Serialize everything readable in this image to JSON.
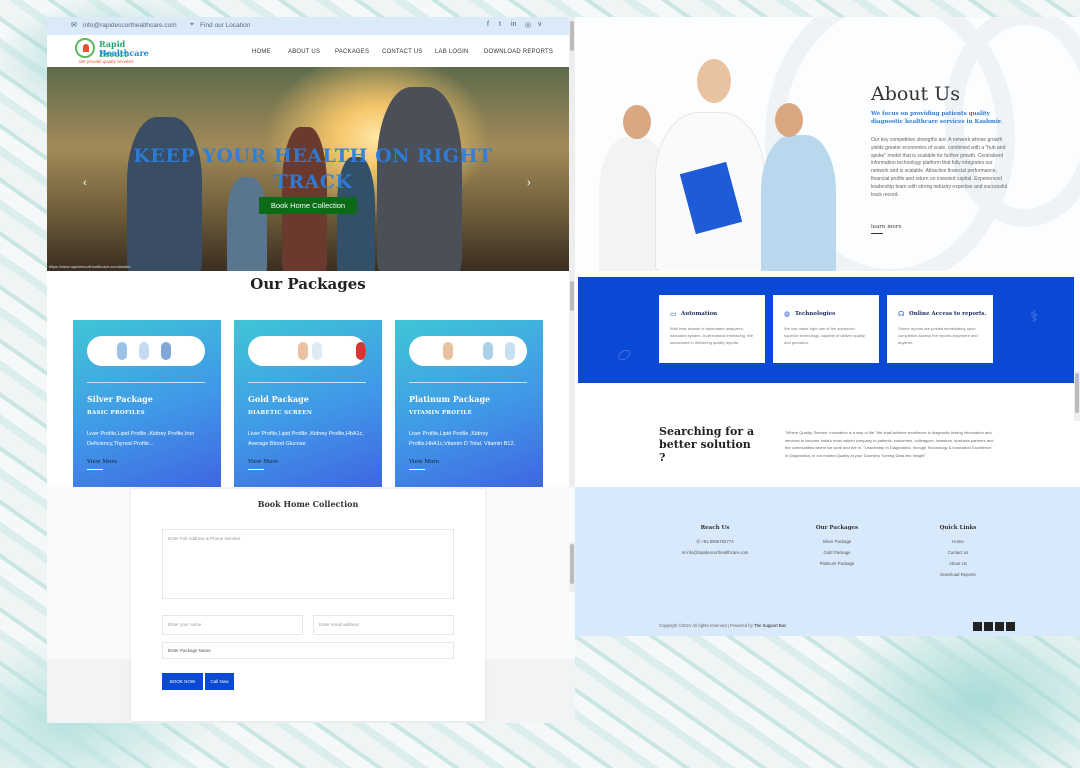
{
  "topbar": {
    "email": "info@rapidescorthealthcare.com",
    "location": "Find our Location",
    "social": [
      "f",
      "t",
      "in",
      "◎",
      "v"
    ]
  },
  "logo": {
    "line1": "Rapid Escort",
    "line2": "Healthcare",
    "tagline": "We provide quality services"
  },
  "nav": [
    "HOME",
    "ABOUT US",
    "PACKAGES",
    "CONTACT US",
    "LAB LOGIN",
    "DOWNLOAD REPORTS"
  ],
  "hero": {
    "headline": "KEEP YOUR HEALTH ON RIGHT TRACK",
    "button": "Book Home Collection",
    "url": "https://www.rapidescorthealthcare.com/#slider"
  },
  "about": {
    "title": "About Us",
    "lead": "We focus on providing patients quality diagnostic healthcare services in Kashmir.",
    "body": "Our key competitive strengths are: A network whose growth yields greater economies of scale, combined with a \"hub and spoke\" model that is scalable for further growth. Centralized information technology platform that fully integrates our network and is scalable. Attractive financial performance, financial profile and return on invested capital. Experienced leadership team with strong industry expertise and successful track record.",
    "more": "learn more"
  },
  "packages": {
    "title": "Our Packages",
    "items": [
      {
        "name": "Silver Package",
        "profile": "BASIC PROFILES",
        "desc": "Liver Profile,Lipid Profile ,Kidney Profile,Iron Deficiency,Thyroid Profile...",
        "link": "View More"
      },
      {
        "name": "Gold Package",
        "profile": "DIABETIC SCREEN",
        "desc": "Liver Profile,Lipid Profile ,Kidney Profile,HbA1c, Average Blood Glucose",
        "link": "View More"
      },
      {
        "name": "Platinum Package",
        "profile": "VITAMIN PROFILE",
        "desc": "Liver Profile,Lipid Profile ,Kidney Profile,HbA1c,Vitamin D Total, Vitamin B12,",
        "link": "View More"
      }
    ]
  },
  "features": [
    {
      "title": "Automation",
      "icon": "monitor-icon",
      "desc": "With best brands of automated analyzers, barcoded system, bi-directional interfacing, We succeeded in delivering quality reports."
    },
    {
      "title": "Technologies",
      "icon": "globe-icon",
      "desc": "We has made right use of the advanced superior technology, capable of deliver quality and precision."
    },
    {
      "title": "Online Access to reports.",
      "icon": "headset-icon",
      "desc": "Online reports are posted immediately upon completion Access the reports anywhere and anytime."
    }
  ],
  "search": {
    "question": "Searching for a better solution ?",
    "quote": "\"Where Quality, Service, Innovation is a way of life\" We shall achieve excellence in diagnostic testing information and services to become India's most valued company to patients, customers, colleagues, investors, business partners and the communities where we work and live in. \"Leadership in Diagnostics, through Technology & Innovation Excellence in Diagnostics, in our mantra Quality at your Doorstep Turning Data into Insight\""
  },
  "booking": {
    "title": "Book Home Collection",
    "address_ph": "Enter Full Address & Phone Number",
    "name_ph": "Enter your name",
    "email_ph": "Enter email address",
    "package_ph": "Enter Package Name",
    "book": "BOOK NOW",
    "call": "Call Now"
  },
  "footer": {
    "reach": {
      "title": "Reach Us",
      "phone": "+91 9906792774",
      "email": "info@rapidescorthealthcare.com"
    },
    "packages": {
      "title": "Our Packages",
      "items": [
        "Silver Package",
        "Gold Package",
        "Platinum Package"
      ]
    },
    "links": {
      "title": "Quick Links",
      "items": [
        "Home",
        "Contact us",
        "About Us",
        "Download Reports"
      ]
    },
    "copyright": "Copyright ©2021 All rights reserved | Powered by",
    "powered": "The Support Box"
  }
}
